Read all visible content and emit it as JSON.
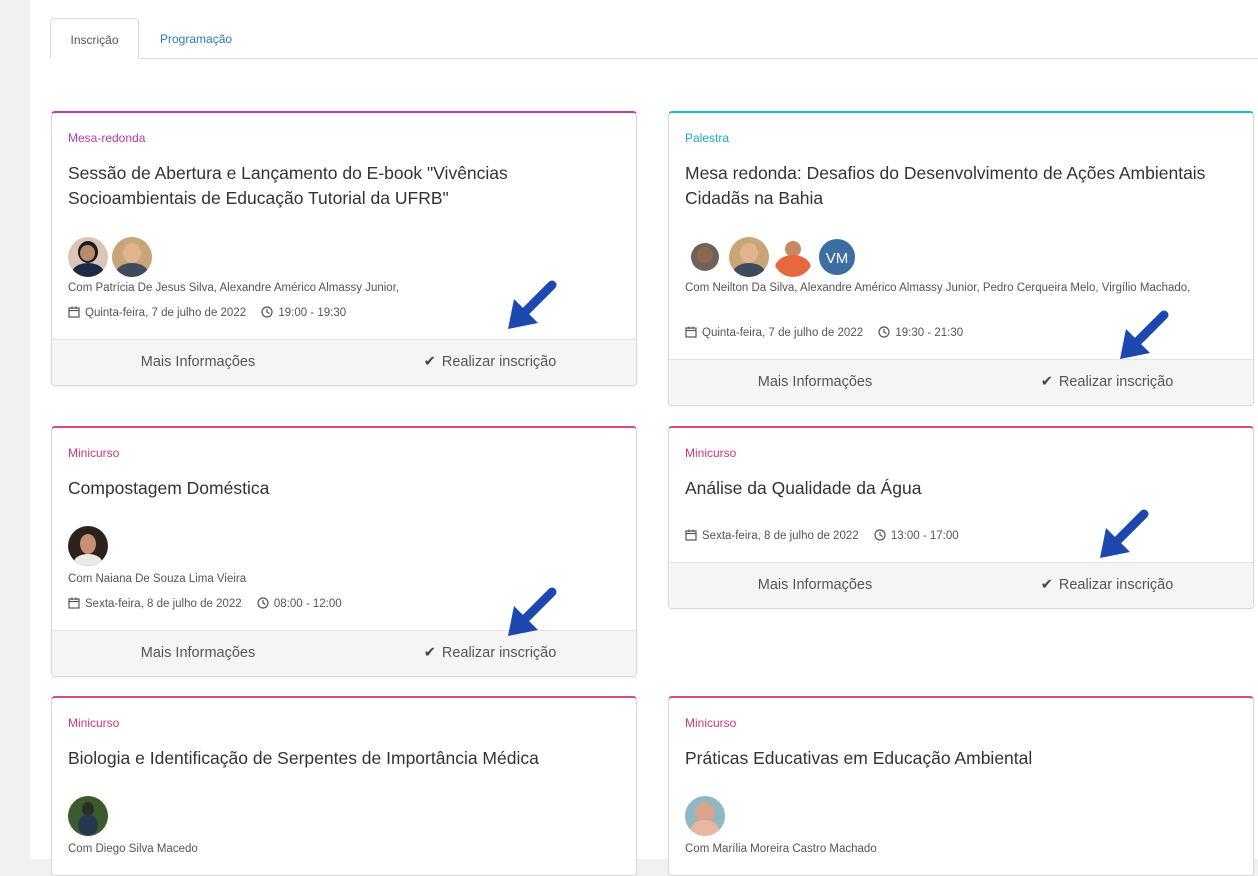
{
  "tabs": [
    {
      "label": "Inscrição"
    },
    {
      "label": "Programação"
    }
  ],
  "cards": [
    {
      "type": "Mesa-redonda",
      "title": "Sessão de Abertura e Lançamento do E-book \"Vivências Socioambientais de Educação Tutorial da UFRB\"",
      "presenters": "Com Patrícia De Jesus Silva, Alexandre Américo Almassy Junior,",
      "date": "Quinta-feira, 7 de julho de 2022",
      "time": "19:00 - 19:30",
      "more": "Mais Informações",
      "register": "Realizar inscrição"
    },
    {
      "type": "Palestra",
      "title": "Mesa redonda: Desafios do Desenvolvimento de Ações Ambientais Cidadãs na Bahia",
      "presenters": "Com Neilton Da Silva, Alexandre Américo Almassy Junior, Pedro Cerqueira Melo, Virgílio Machado,",
      "avatar_initials": "VM",
      "date": "Quinta-feira, 7 de julho de 2022",
      "time": "19:30 - 21:30",
      "more": "Mais Informações",
      "register": "Realizar inscrição"
    },
    {
      "type": "Minicurso",
      "title": "Compostagem Doméstica",
      "presenters": "Com Naiana De Souza Lima Vieira",
      "date": "Sexta-feira, 8 de julho de 2022",
      "time": "08:00 - 12:00",
      "more": "Mais Informações",
      "register": "Realizar inscrição"
    },
    {
      "type": "Minicurso",
      "title": "Análise da Qualidade da Água",
      "date": "Sexta-feira, 8 de julho de 2022",
      "time": "13:00 - 17:00",
      "more": "Mais Informações",
      "register": "Realizar inscrição"
    },
    {
      "type": "Minicurso",
      "title": "Biologia e Identificação de Serpentes de Importância Médica",
      "presenters": "Com Diego Silva Macedo"
    },
    {
      "type": "Minicurso",
      "title": "Práticas Educativas em Educação Ambiental",
      "presenters": "Com Marília Moreira Castro Machado"
    }
  ],
  "colors": {
    "mesa_redonda": "#c43aa9",
    "palestra": "#22b5d2",
    "minicurso": "#d9497f",
    "annotation_arrow": "#1d48b0",
    "link": "#2a7ab8"
  }
}
